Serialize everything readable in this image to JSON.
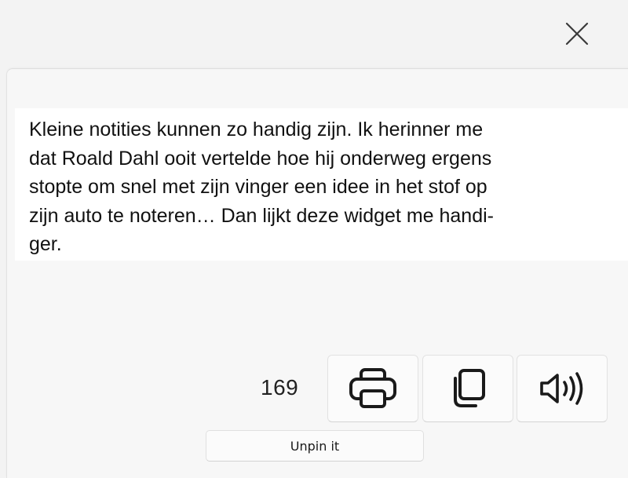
{
  "window": {
    "close_icon": "close-icon"
  },
  "note": {
    "text": "Kleine notities kunnen zo handig zijn. Ik herinner me\ndat Roald Dahl ooit vertelde hoe hij onderweg ergens\nstopte om snel met zijn vinger een idee in het stof op\nzijn auto te noteren… Dan lijkt deze widget me handi-\nger."
  },
  "footer": {
    "char_count": "169",
    "buttons": [
      {
        "name": "print",
        "icon": "printer-icon"
      },
      {
        "name": "copy",
        "icon": "copy-icon"
      },
      {
        "name": "speak",
        "icon": "speaker-icon"
      }
    ],
    "unpin_label": "Unpin it"
  }
}
